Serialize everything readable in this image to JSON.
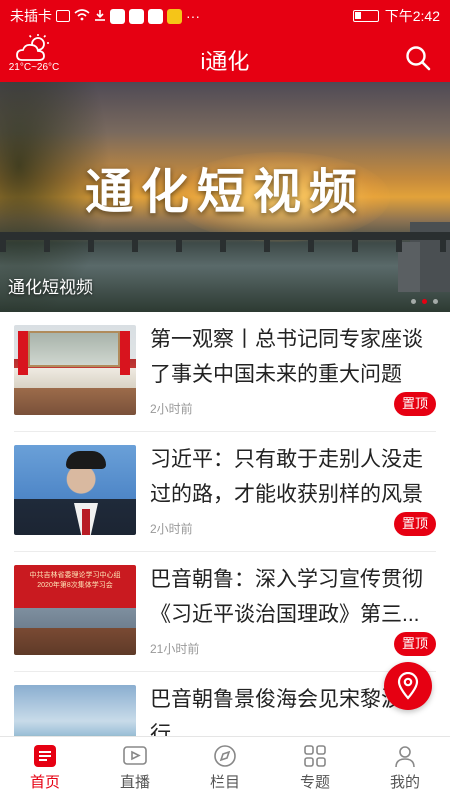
{
  "status_bar": {
    "carrier": "未插卡",
    "time": "下午2:42",
    "more": "···"
  },
  "header": {
    "title": "i通化",
    "weather": {
      "temp": "21°C~26°C",
      "icon": "cloudy-weather-icon"
    },
    "search_icon": "search-icon"
  },
  "banner": {
    "overlay_title": "通化短视频",
    "caption": "通化短视频",
    "slides": 3,
    "active_slide": 2
  },
  "news": [
    {
      "title": "第一观察丨总书记同专家座谈了事关中国未来的重大问题",
      "time": "2小时前",
      "badge": "置顶"
    },
    {
      "title": "习近平：只有敢于走别人没走过的路，才能收获别样的风景",
      "time": "2小时前",
      "badge": "置顶"
    },
    {
      "title": "巴音朝鲁：深入学习宣传贯彻《习近平谈治国理政》第三...",
      "time": "21小时前",
      "badge": "置顶"
    },
    {
      "title": "巴音朝鲁景俊海会见宋黎波一行",
      "time": "",
      "badge": ""
    }
  ],
  "thumb3_text": {
    "line1": "中共吉林省委理论学习中心组",
    "line2": "2020年第8次集体学习会"
  },
  "tabs": [
    {
      "label": "首页",
      "icon": "home-news-icon",
      "active": true
    },
    {
      "label": "直播",
      "icon": "live-video-icon",
      "active": false
    },
    {
      "label": "栏目",
      "icon": "columns-compass-icon",
      "active": false
    },
    {
      "label": "专题",
      "icon": "topics-grid-icon",
      "active": false
    },
    {
      "label": "我的",
      "icon": "user-profile-icon",
      "active": false
    }
  ],
  "colors": {
    "brand_red": "#e60012",
    "muted": "#999999"
  }
}
